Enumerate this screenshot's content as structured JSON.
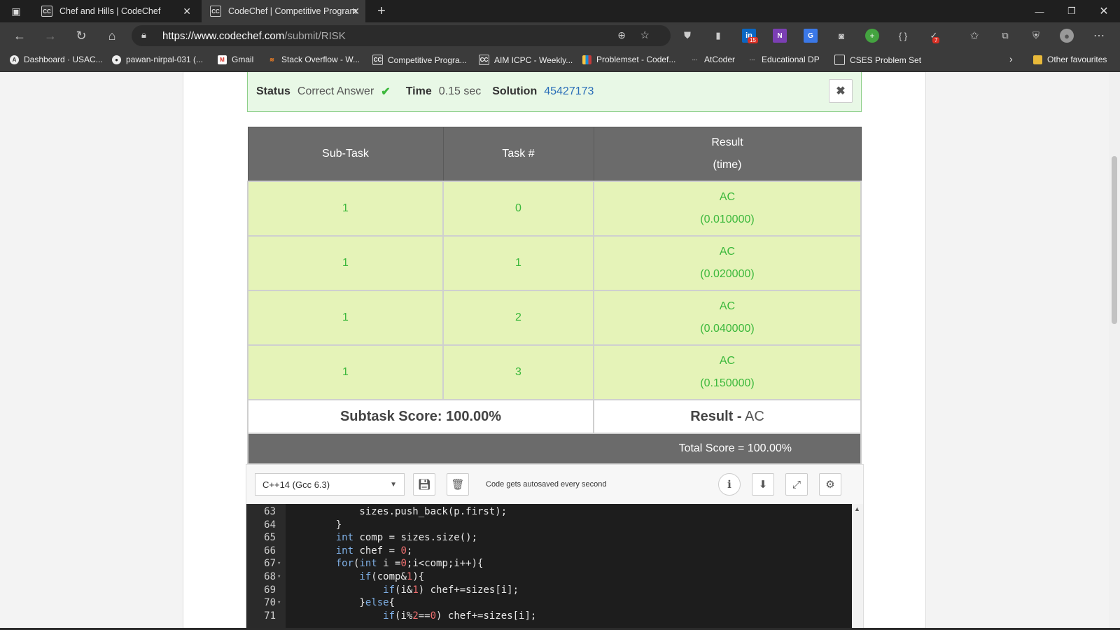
{
  "browser": {
    "tabs": [
      {
        "icon": "CC",
        "title": "Chef and Hills | CodeChef"
      },
      {
        "icon": "CC",
        "title": "CodeChef | Competitive Program"
      }
    ],
    "url": {
      "host": "https://www.codechef.com",
      "path": "/submit/RISK"
    },
    "ext_badges": {
      "linkedin": "15",
      "mail": "7"
    },
    "bookmarks": [
      {
        "label": "Dashboard · USAC...",
        "icon": "usaco-icon"
      },
      {
        "label": "pawan-nirpal-031 (...",
        "icon": "github-icon"
      },
      {
        "label": "Gmail",
        "icon": "gmail-icon"
      },
      {
        "label": "Stack Overflow - W...",
        "icon": "stackoverflow-icon"
      },
      {
        "label": "Competitive Progra...",
        "icon": "codechef-icon"
      },
      {
        "label": "AIM ICPC - Weekly...",
        "icon": "codechef-icon"
      },
      {
        "label": "Problemset - Codef...",
        "icon": "codeforces-icon"
      },
      {
        "label": "AtCoder",
        "icon": "atcoder-icon"
      },
      {
        "label": "Educational DP",
        "icon": "atcoder-icon"
      },
      {
        "label": "CSES Problem Set",
        "icon": "page-icon"
      }
    ],
    "other_favourites": "Other favourites"
  },
  "status_bar": {
    "status_label": "Status",
    "status_value": "Correct Answer",
    "check": "✔",
    "time_label": "Time",
    "time_value": "0.15 sec",
    "solution_label": "Solution",
    "solution_id": "45427173",
    "close": "✖"
  },
  "results": {
    "headers": {
      "subtask": "Sub-Task",
      "task": "Task #",
      "result_line1": "Result",
      "result_line2": "(time)"
    },
    "rows": [
      {
        "subtask": "1",
        "task": "0",
        "result": "AC",
        "time": "(0.010000)"
      },
      {
        "subtask": "1",
        "task": "1",
        "result": "AC",
        "time": "(0.020000)"
      },
      {
        "subtask": "1",
        "task": "2",
        "result": "AC",
        "time": "(0.040000)"
      },
      {
        "subtask": "1",
        "task": "3",
        "result": "AC",
        "time": "(0.150000)"
      }
    ],
    "subtask_score": "Subtask Score: 100.00%",
    "result_label": "Result -",
    "result_value": "AC",
    "total_score": "Total Score = 100.00%"
  },
  "editor": {
    "language": "C++14 (Gcc 6.3)",
    "autosave": "Code gets autosaved every second",
    "lines": [
      {
        "n": "63",
        "fold": "",
        "parts": [
          [
            "",
            "        sizes.push_back(p.first);"
          ]
        ]
      },
      {
        "n": "64",
        "fold": "",
        "parts": [
          [
            "",
            "    }"
          ]
        ]
      },
      {
        "n": "65",
        "fold": "",
        "parts": [
          [
            "kw",
            "    int"
          ],
          [
            "",
            " comp = sizes.size();"
          ]
        ]
      },
      {
        "n": "66",
        "fold": "",
        "parts": [
          [
            "kw",
            "    int"
          ],
          [
            "",
            " chef = "
          ],
          [
            "num",
            "0"
          ],
          [
            "",
            ";"
          ]
        ]
      },
      {
        "n": "67",
        "fold": "▾",
        "parts": [
          [
            "kw",
            "    for"
          ],
          [
            "",
            "("
          ],
          [
            "kw",
            "int"
          ],
          [
            "",
            " i ="
          ],
          [
            "num",
            "0"
          ],
          [
            "",
            ";i<comp;i++){"
          ]
        ]
      },
      {
        "n": "68",
        "fold": "▾",
        "parts": [
          [
            "kw",
            "        if"
          ],
          [
            "",
            "(comp&"
          ],
          [
            "num",
            "1"
          ],
          [
            "",
            "){"
          ]
        ]
      },
      {
        "n": "69",
        "fold": "",
        "parts": [
          [
            "kw",
            "            if"
          ],
          [
            "",
            "(i&"
          ],
          [
            "num",
            "1"
          ],
          [
            "",
            ") chef+=sizes[i];"
          ]
        ]
      },
      {
        "n": "70",
        "fold": "▾",
        "parts": [
          [
            "",
            "        }"
          ],
          [
            "kw",
            "else"
          ],
          [
            "",
            "{"
          ]
        ]
      },
      {
        "n": "71",
        "fold": "",
        "parts": [
          [
            "kw",
            "            if"
          ],
          [
            "",
            "(i%"
          ],
          [
            "num",
            "2"
          ],
          [
            "",
            "=="
          ],
          [
            "num",
            "0"
          ],
          [
            "",
            ") chef+=sizes[i];"
          ]
        ]
      }
    ]
  }
}
